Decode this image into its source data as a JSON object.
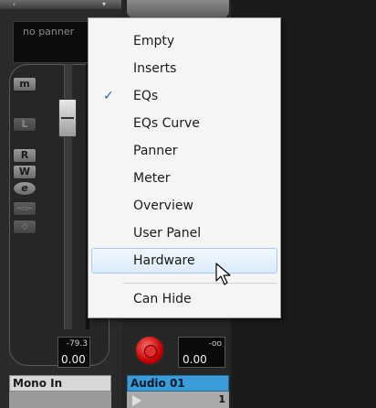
{
  "left_channel": {
    "panner_text": "no panner",
    "buttons": [
      "m",
      "L",
      "R",
      "W",
      "e"
    ],
    "fader_peak": "-79.3",
    "fader_value": "0.00",
    "name": "Mono In"
  },
  "right_channel": {
    "peak": "-oo",
    "value": "0.00",
    "name": "Audio 01",
    "number": "1",
    "name_color": "#3c9bd9"
  },
  "context_menu": {
    "items": [
      {
        "label": "Empty",
        "checked": false
      },
      {
        "label": "Inserts",
        "checked": false
      },
      {
        "label": "EQs",
        "checked": true
      },
      {
        "label": "EQs Curve",
        "checked": false
      },
      {
        "label": "Panner",
        "checked": false
      },
      {
        "label": "Meter",
        "checked": false
      },
      {
        "label": "Overview",
        "checked": false
      },
      {
        "label": "User Panel",
        "checked": false
      },
      {
        "label": "Hardware",
        "checked": false,
        "highlighted": true
      },
      {
        "label": "Can Hide",
        "checked": false
      }
    ],
    "check_glyph": "✓",
    "highlight_color": "#dcebfb"
  },
  "cursor": "arrow-pointer-icon"
}
